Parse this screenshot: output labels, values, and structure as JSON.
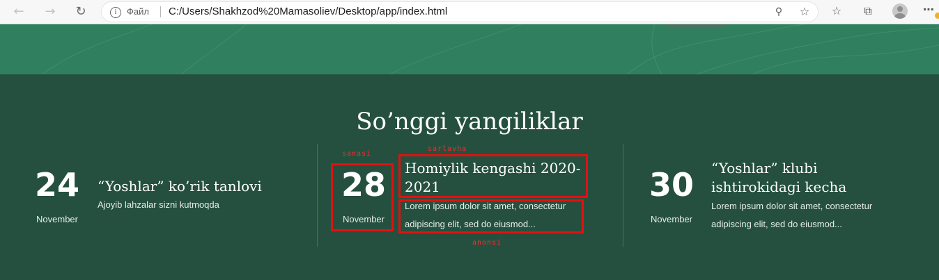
{
  "browser": {
    "site_label": "Файл",
    "url": "C:/Users/Shakhzod%20Mamasoliev/Desktop/app/index.html",
    "icons": [
      "back-icon",
      "forward-icon",
      "refresh-icon",
      "info-icon",
      "zoom-out-icon",
      "favorite-add-icon",
      "favorites-icon",
      "collections-icon",
      "profile-icon",
      "more-icon"
    ]
  },
  "section": {
    "title": "So’nggi yangiliklar"
  },
  "news": [
    {
      "day": "24",
      "month": "November",
      "title": "“Yoshlar” ko’rik tanlovi",
      "desc": "Ajoyib lahzalar sizni kutmoqda"
    },
    {
      "day": "28",
      "month": "November",
      "title": "Homiylik kengashi 2020-2021",
      "desc": "Lorem ipsum dolor sit amet, consectetur adipiscing elit, sed do eiusmod..."
    },
    {
      "day": "30",
      "month": "November",
      "title": "“Yoshlar” klubi ishtirokidagi kecha",
      "desc": "Lorem ipsum dolor sit amet, consectetur adipiscing elit, sed do eiusmod..."
    }
  ],
  "annotations": {
    "date_label": "sanasi",
    "title_label": "sarlavha",
    "desc_label": "anonsi",
    "color": "#e41010"
  },
  "colors": {
    "section_bg": "#25503f",
    "hero_bg": "#30805f"
  }
}
